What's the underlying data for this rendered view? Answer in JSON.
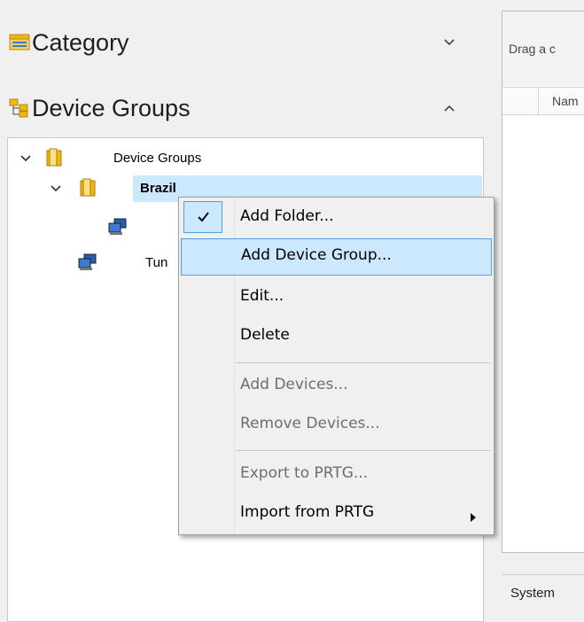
{
  "left_panel": {
    "category": {
      "label": "Category",
      "icon": "category-icon",
      "state": "collapsed"
    },
    "device_groups": {
      "label": "Device Groups",
      "icon": "device-groups-icon",
      "state": "expanded"
    }
  },
  "tree": {
    "root": {
      "label": "Device Groups",
      "icon": "folder-icon"
    },
    "brazil": {
      "label": "Brazil",
      "icon": "folder-icon",
      "selected": true
    },
    "brazil_child": {
      "label": "",
      "icon": "device-icon"
    },
    "tun": {
      "label": "Tun",
      "icon": "device-icon"
    }
  },
  "grid": {
    "group_bar_text": "Drag a c",
    "column_header": "Nam",
    "status_text": "System"
  },
  "context_menu": {
    "items": [
      {
        "label": "Add Folder...",
        "checked": true,
        "enabled": true
      },
      {
        "label": "Add Device Group...",
        "enabled": true,
        "highlighted": true
      },
      {
        "label": "Edit...",
        "enabled": true
      },
      {
        "label": "Delete",
        "enabled": true
      },
      {
        "label": "Add Devices...",
        "enabled": false
      },
      {
        "label": "Remove Devices...",
        "enabled": false
      },
      {
        "label": "Export to PRTG...",
        "enabled": false
      },
      {
        "label": "Import from PRTG",
        "enabled": true,
        "submenu": true
      }
    ]
  },
  "colors": {
    "selection": "#cce8ff",
    "highlight_border": "#569de5",
    "disabled_text": "#6d6d6d",
    "folder": "#f2b70a"
  }
}
